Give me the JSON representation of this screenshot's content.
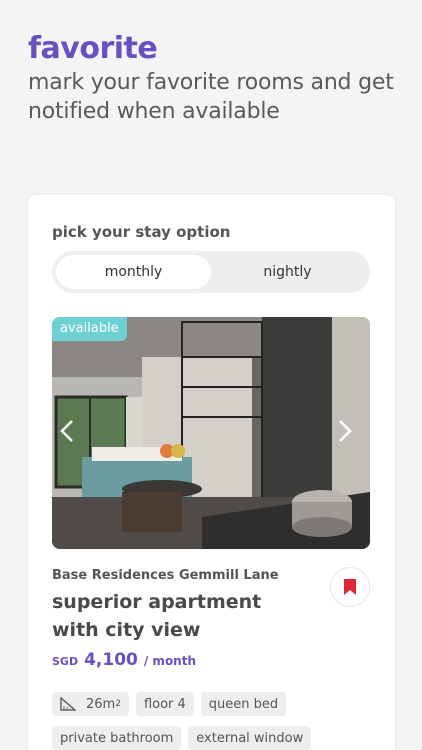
{
  "header": {
    "title": "favorite",
    "subtitle": "mark your favorite rooms and get notified when available"
  },
  "card": {
    "pick_label": "pick your stay option",
    "stay_options": [
      {
        "label": "monthly",
        "selected": true
      },
      {
        "label": "nightly",
        "selected": false
      }
    ],
    "photo": {
      "badge": "available",
      "prev_icon": "chevron-left-icon",
      "next_icon": "chevron-right-icon"
    },
    "location": "Base Residences Gemmill Lane",
    "room_name": "superior apartment with city view",
    "bookmark_icon": "bookmark-icon",
    "price": {
      "currency": "SGD",
      "amount": "4,100",
      "period": "/ month"
    },
    "amenities": {
      "size_icon": "ruler-icon",
      "size_value": "26m",
      "size_unit_sup": "2",
      "floor": "floor 4",
      "bed": "queen bed",
      "bathroom": "private bathroom",
      "window": "external window"
    }
  },
  "colors": {
    "accent": "#6a4fc2",
    "badge": "#6fd0d4",
    "bookmark": "#e0243a",
    "background": "#f4f4f4"
  }
}
